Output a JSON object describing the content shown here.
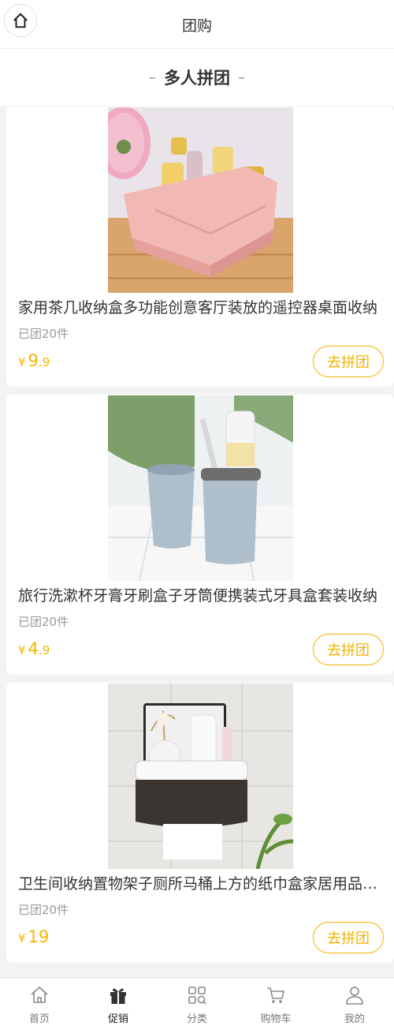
{
  "header": {
    "title": "团购",
    "home_icon": "home-icon"
  },
  "section": {
    "dash_left": "–",
    "title": "多人拼团",
    "dash_right": "–"
  },
  "products": [
    {
      "title": "家用茶几收纳盒多功能创意客厅装放的遥控器桌面收纳",
      "sold": "已团20件",
      "currency": "¥",
      "price_int": "9",
      "price_dec": ".9",
      "button": "去拼团",
      "image": "pink-cosmetic-organizer"
    },
    {
      "title": "旅行洗漱杯牙膏牙刷盒子牙筒便携装式牙具盒套装收纳",
      "sold": "已团20件",
      "currency": "¥",
      "price_int": "4",
      "price_dec": ".9",
      "button": "去拼团",
      "image": "blue-toothbrush-cups"
    },
    {
      "title": "卫生间收纳置物架子厕所马桶上方的纸巾盒家居用品收纳",
      "sold": "已团20件",
      "currency": "¥",
      "price_int": "19",
      "price_dec": "",
      "button": "去拼团",
      "image": "bathroom-tissue-box"
    }
  ],
  "tabbar": [
    {
      "label": "首页",
      "icon": "home-icon",
      "active": false
    },
    {
      "label": "促销",
      "icon": "gift-icon",
      "active": true
    },
    {
      "label": "分类",
      "icon": "category-icon",
      "active": false
    },
    {
      "label": "购物车",
      "icon": "cart-icon",
      "active": false
    },
    {
      "label": "我的",
      "icon": "user-icon",
      "active": false
    }
  ],
  "colors": {
    "accent": "#f5b400",
    "background": "#f3f3f3"
  }
}
